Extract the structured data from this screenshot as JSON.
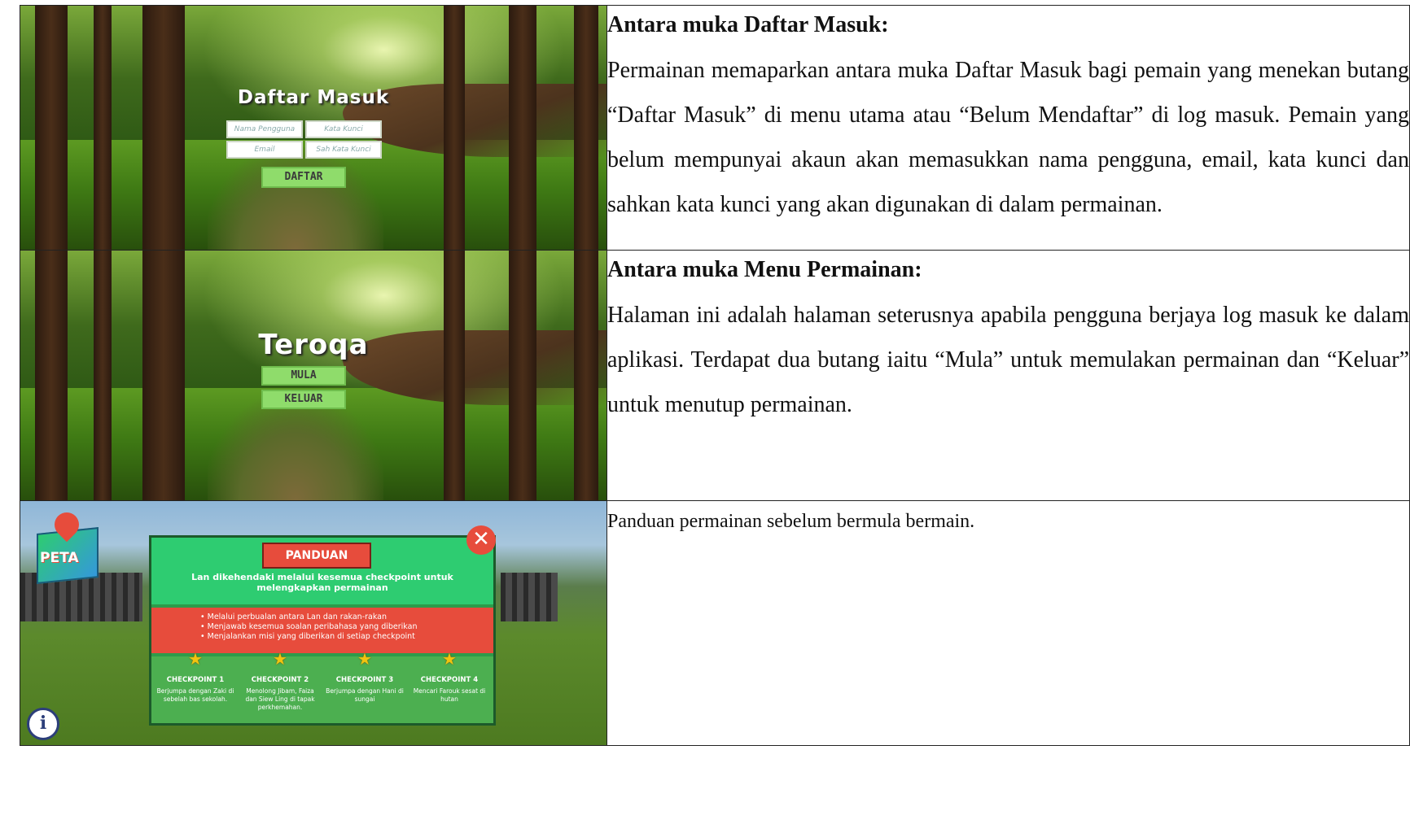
{
  "rows": [
    {
      "title": "Antara muka Daftar Masuk:",
      "body": "Permainan memaparkan antara muka Daftar Masuk bagi pemain yang menekan butang “Daftar Masuk” di menu utama atau “Belum Mendaftar” di log masuk. Pemain yang belum mempunyai akaun akan memasukkan nama pengguna, email, kata kunci dan sahkan kata kunci yang akan digunakan di dalam permainan.",
      "screen": {
        "heading": "Daftar Masuk",
        "fields": [
          "Nama Pengguna",
          "Kata Kunci",
          "Email",
          "Sah Kata Kunci"
        ],
        "button": "DAFTAR"
      }
    },
    {
      "title": "Antara muka Menu Permainan:",
      "body": "Halaman ini adalah halaman seterusnya apabila pengguna berjaya log masuk ke dalam aplikasi. Terdapat dua butang iaitu “Mula” untuk memulakan permainan dan “Keluar” untuk menutup permainan.",
      "screen": {
        "heading": "Teroqa",
        "buttons": [
          "MULA",
          "KELUAR"
        ]
      }
    },
    {
      "body": "Panduan permainan sebelum bermula bermain.",
      "screen": {
        "map_label": "PETA",
        "panel_title": "PANDUAN",
        "intro": "Lan dikehendaki melalui kesemua checkpoint untuk melengkapkan permainan",
        "bullets": [
          "• Melalui perbualan antara Lan dan rakan-rakan",
          "• Menjawab kesemua soalan peribahasa yang diberikan",
          "• Menjalankan misi yang diberikan di setiap checkpoint"
        ],
        "checkpoints": [
          {
            "name": "CHECKPOINT 1",
            "desc": "Berjumpa dengan Zaki di sebelah bas sekolah."
          },
          {
            "name": "CHECKPOINT 2",
            "desc": "Menolong Jibam, Faiza dan Siew Ling di tapak perkhemahan."
          },
          {
            "name": "CHECKPOINT 3",
            "desc": "Berjumpa dengan Hani di sungai"
          },
          {
            "name": "CHECKPOINT 4",
            "desc": "Mencari Farouk sesat di hutan"
          }
        ],
        "close_symbol": "✕",
        "info_symbol": "i",
        "star_symbol": "★"
      }
    }
  ]
}
